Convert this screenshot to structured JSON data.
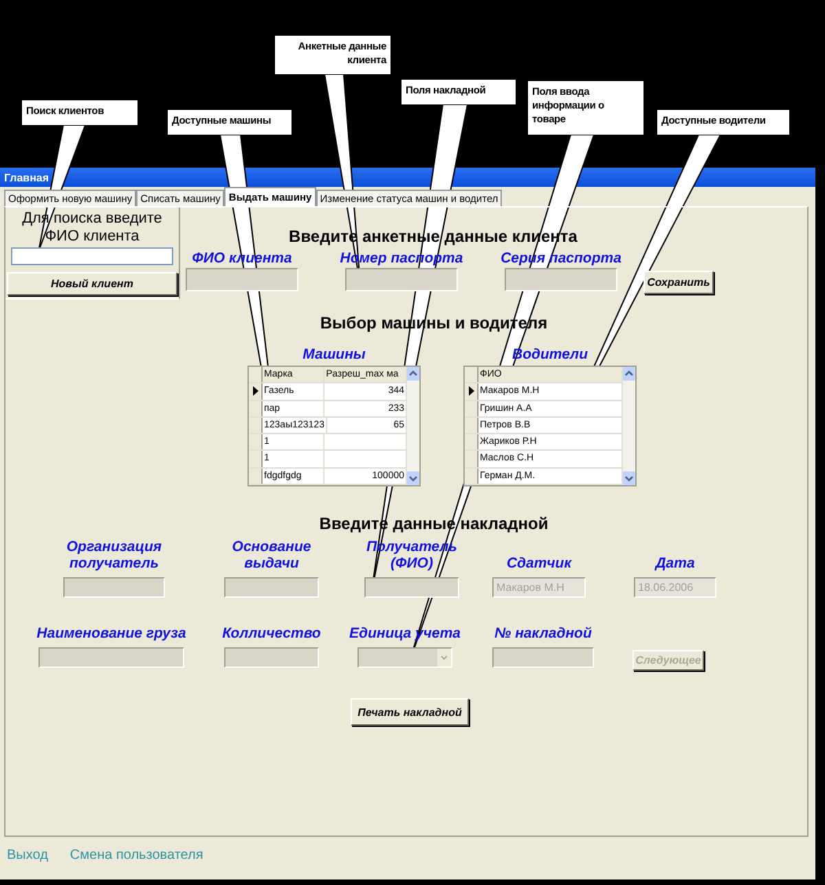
{
  "callouts": [
    {
      "text": "Поиск клиентов"
    },
    {
      "text": "Доступные машины"
    },
    {
      "text": "Анкетные данные клиента"
    },
    {
      "text": "Поля накладной"
    },
    {
      "text": "Поля ввода информации о товаре"
    },
    {
      "text": "Доступные водители"
    }
  ],
  "window": {
    "title": "Главная"
  },
  "tabs": [
    {
      "label": "Оформить новую машину",
      "selected": false
    },
    {
      "label": "Списать машину",
      "selected": false
    },
    {
      "label": "Выдать машину",
      "selected": true
    },
    {
      "label": "Изменение статуса машин и водител",
      "selected": false
    }
  ],
  "search": {
    "label": "Для поиска введите ФИО клиента",
    "button": "Новый клиент"
  },
  "client": {
    "title": "Введите анкетные данные клиента",
    "fields": [
      {
        "label": "ФИО клиента"
      },
      {
        "label": "Номер паспорта"
      },
      {
        "label": "Серия паспорта"
      }
    ],
    "button": "Сохранить"
  },
  "selection": {
    "title": "Выбор машины и водителя",
    "cars": {
      "title": "Машины",
      "columns": [
        "Марка",
        "Разреш_max ма"
      ],
      "rows": [
        {
          "cells": [
            "Газель",
            "344"
          ],
          "selected": true
        },
        {
          "cells": [
            "пар",
            "233"
          ],
          "selected": false
        },
        {
          "cells": [
            "123аы123123",
            "65"
          ],
          "selected": false
        },
        {
          "cells": [
            "1",
            ""
          ],
          "selected": false
        },
        {
          "cells": [
            "1",
            ""
          ],
          "selected": false
        },
        {
          "cells": [
            "fdgdfgdg",
            "100000"
          ],
          "selected": false
        }
      ]
    },
    "drivers": {
      "title": "Водители",
      "columns": [
        "ФИО"
      ],
      "rows": [
        {
          "cells": [
            "Макаров М.Н"
          ],
          "selected": true
        },
        {
          "cells": [
            "Гришин А.А"
          ],
          "selected": false
        },
        {
          "cells": [
            "Петров В.В"
          ],
          "selected": false
        },
        {
          "cells": [
            "Жариков Р.Н"
          ],
          "selected": false
        },
        {
          "cells": [
            "Маслов С.Н"
          ],
          "selected": false
        },
        {
          "cells": [
            "Герман Д.М."
          ],
          "selected": false
        }
      ]
    }
  },
  "invoice": {
    "title": "Введите данные накладной",
    "fields": [
      {
        "label": "Организация получатель",
        "kind": "text",
        "disabled": false
      },
      {
        "label": "Основание выдачи",
        "kind": "text",
        "disabled": false
      },
      {
        "label": "Получатель (ФИО)",
        "kind": "text",
        "disabled": false
      },
      {
        "label": "Сдатчик",
        "kind": "text",
        "disabled": true,
        "value": "Макаров М.Н"
      },
      {
        "label": "Дата",
        "kind": "text",
        "disabled": true,
        "value": "18.06.2006"
      }
    ],
    "goods": [
      {
        "label": "Наименование груза",
        "kind": "text",
        "disabled": false
      },
      {
        "label": "Колличество",
        "kind": "text",
        "disabled": false
      },
      {
        "label": "Единица учета",
        "kind": "select",
        "disabled": false
      },
      {
        "label": "№ накладной",
        "kind": "text",
        "disabled": false
      }
    ],
    "next_button": {
      "label": "Следующее",
      "disabled": true
    },
    "print_button": "Печать накладной"
  },
  "footer": {
    "links": [
      "Выход",
      "Смена пользователя"
    ]
  }
}
